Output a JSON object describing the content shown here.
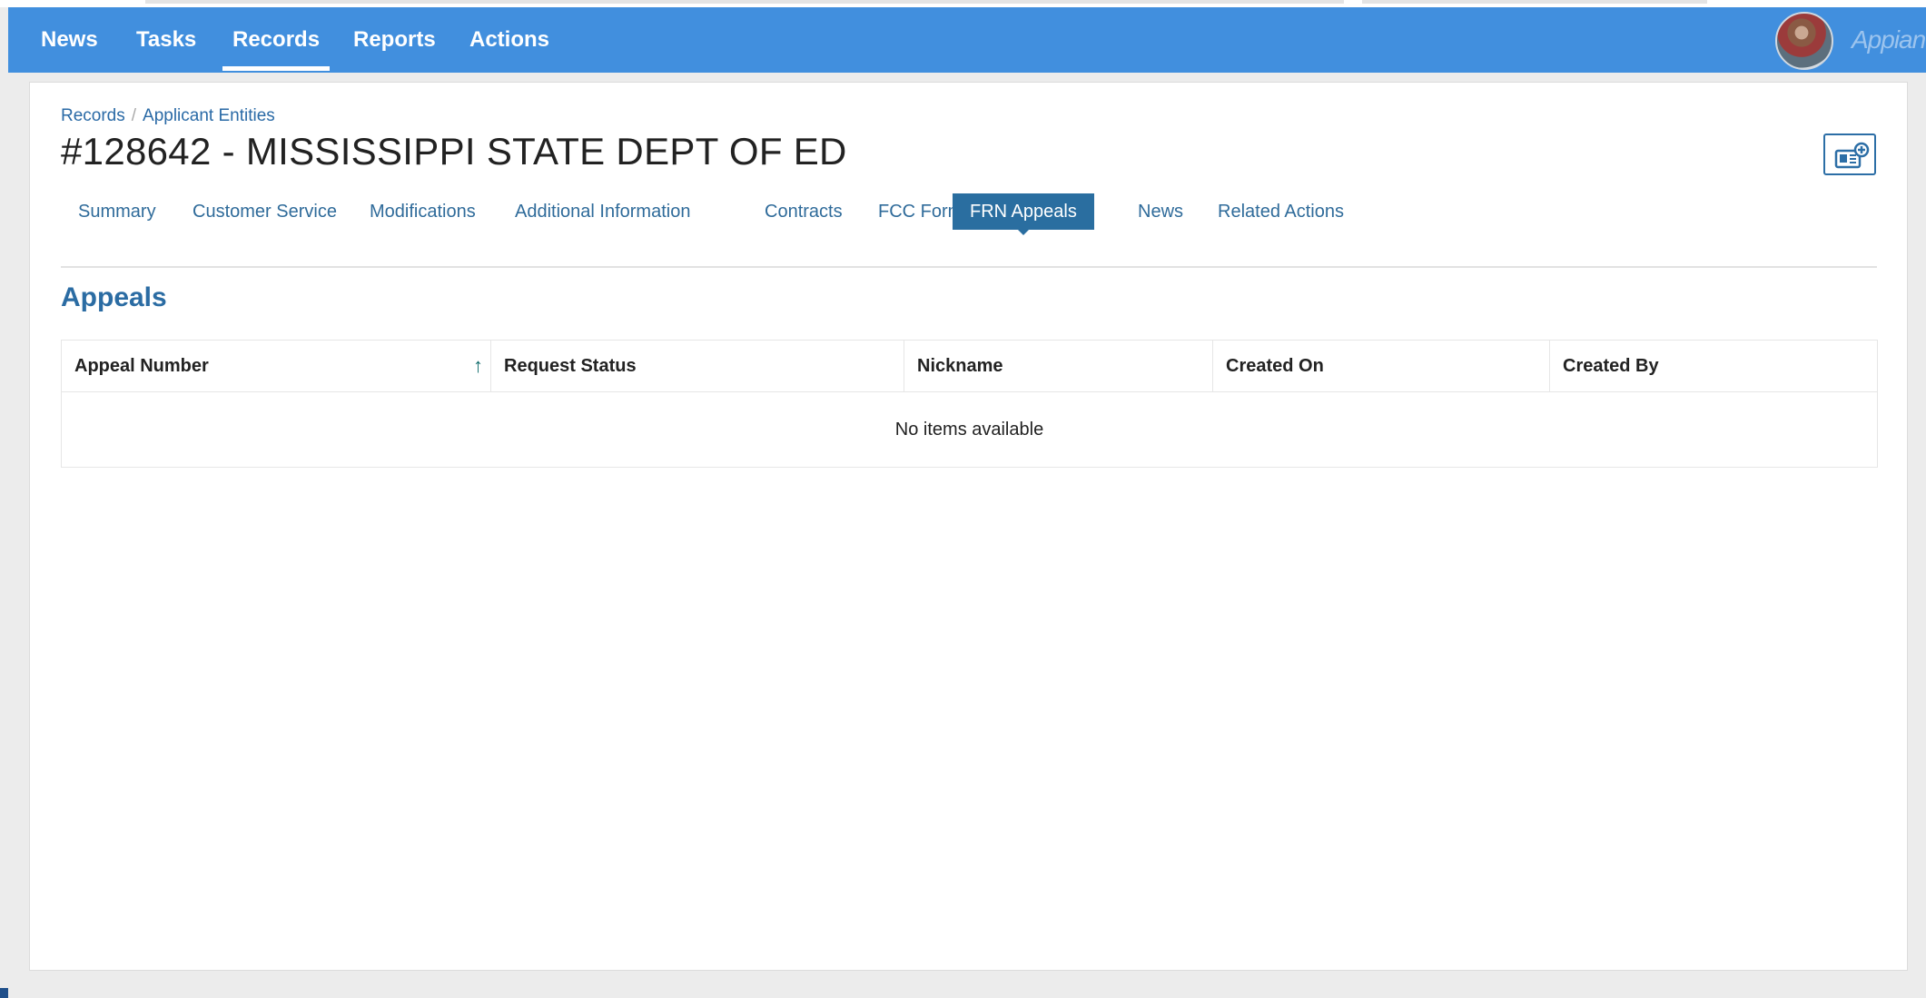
{
  "nav": {
    "items": [
      {
        "label": "News",
        "active": false
      },
      {
        "label": "Tasks",
        "active": false
      },
      {
        "label": "Records",
        "active": true
      },
      {
        "label": "Reports",
        "active": false
      },
      {
        "label": "Actions",
        "active": false
      }
    ],
    "brand": "Appian",
    "avatar_icon": "user-avatar-icon"
  },
  "breadcrumb": {
    "items": [
      "Records",
      "Applicant Entities"
    ],
    "separator": "/"
  },
  "page": {
    "title": "#128642 - MISSISSIPPI STATE DEPT OF ED",
    "action_icon": "add-to-news-icon"
  },
  "tabs": {
    "items": [
      {
        "label": "Summary",
        "active": false
      },
      {
        "label": "Customer Service",
        "active": false
      },
      {
        "label": "Modifications",
        "active": false
      },
      {
        "label": "Additional Information",
        "active": false
      },
      {
        "label": "Contracts",
        "active": false
      },
      {
        "label": "FCC Forms",
        "active": false
      },
      {
        "label": "FRN Appeals",
        "active": true
      },
      {
        "label": "News",
        "active": false
      },
      {
        "label": "Related Actions",
        "active": false
      }
    ]
  },
  "appeals": {
    "title": "Appeals",
    "columns": [
      "Appeal Number",
      "Request Status",
      "Nickname",
      "Created On",
      "Created By"
    ],
    "sort_column": "Appeal Number",
    "sort_direction": "ascending",
    "sort_glyph": "↑",
    "empty_text": "No items available"
  },
  "colors": {
    "nav_bg": "#418fde",
    "accent": "#2a6ea0",
    "link": "#2f6b9a",
    "title": "#222222"
  }
}
